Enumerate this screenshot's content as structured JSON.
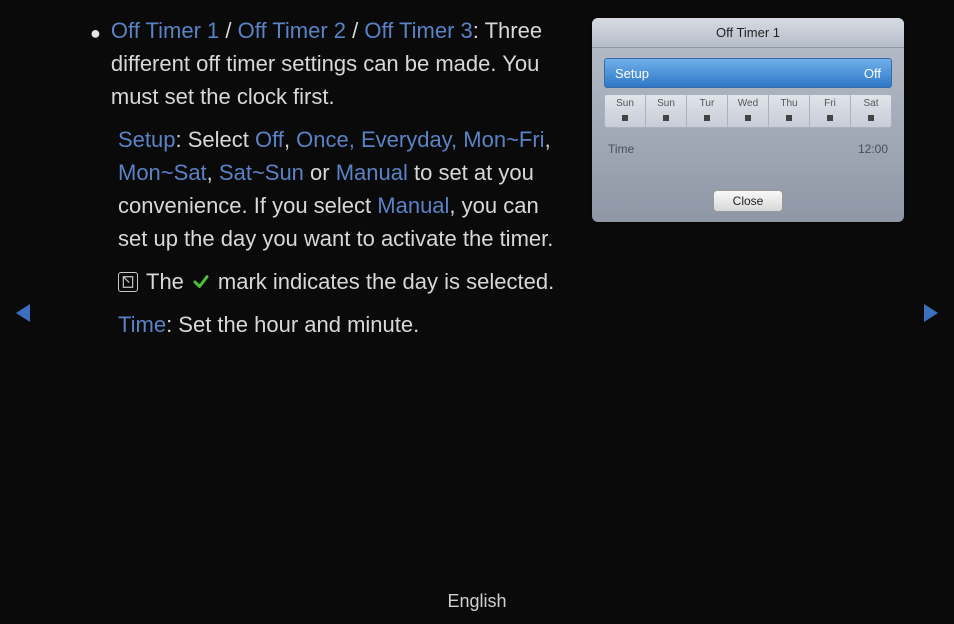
{
  "bullet": "●",
  "title_parts": {
    "t1": "Off Timer 1",
    "sep1": " / ",
    "t2": "Off Timer 2",
    "sep2": " / ",
    "t3": "Off Timer 3"
  },
  "title_tail": ": Three different off timer settings can be made. You must set the clock first.",
  "setup_label": "Setup",
  "setup_tail1": ": Select ",
  "opt_off": "Off",
  "comma1": ", ",
  "opt_once_every": "Once, Everyday, Mon~Fri",
  "comma2": ", ",
  "opt_monsat": "Mon~Sat",
  "comma3": ", ",
  "opt_satsun": "Sat~Sun",
  "or_txt": " or ",
  "opt_manual": "Manual",
  "setup_tail2": " to set at you convenience. If you select ",
  "opt_manual2": "Manual",
  "setup_tail3": ", you can set up the day you want to activate the timer.",
  "note_before": "The ",
  "note_after": " mark indicates the day is selected.",
  "time_label": "Time",
  "time_tail": ": Set the hour and minute.",
  "footer": "English",
  "panel": {
    "title": "Off Timer 1",
    "setup_key": "Setup",
    "setup_val": "Off",
    "days": [
      "Sun",
      "Sun",
      "Tur",
      "Wed",
      "Thu",
      "Fri",
      "Sat"
    ],
    "time_key": "Time",
    "time_val": "12:00",
    "close": "Close"
  }
}
